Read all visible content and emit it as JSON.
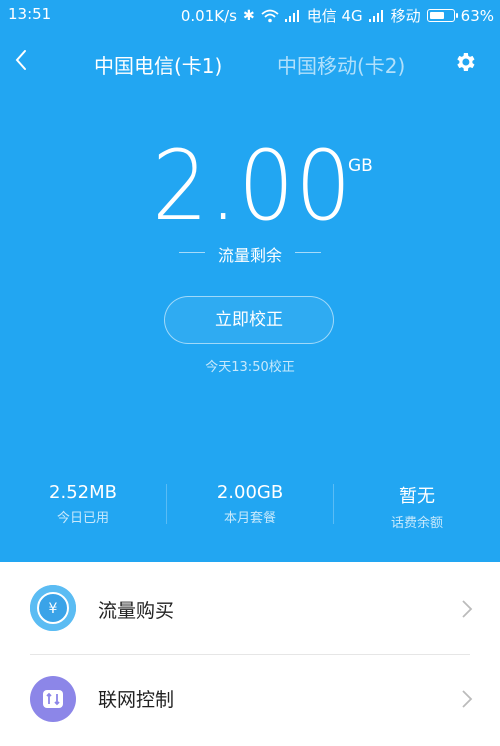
{
  "status_bar": {
    "time": "13:51",
    "speed": "0.01K/s",
    "carrier1": "电信 4G",
    "carrier2": "移动",
    "battery": "63%",
    "battery_level": 0.63
  },
  "header": {
    "tab_sim1": "中国电信(卡1)",
    "tab_sim2": "中国移动(卡2)"
  },
  "usage": {
    "remaining_value": "2.00",
    "remaining_unit": "GB",
    "remaining_label": "流量剩余",
    "calibrate_button": "立即校正",
    "calibrated_at": "今天13:50校正"
  },
  "stats": [
    {
      "value": "2.52MB",
      "label": "今日已用"
    },
    {
      "value": "2.00GB",
      "label": "本月套餐"
    },
    {
      "value": "暂无",
      "label": "话费余额"
    }
  ],
  "menu": {
    "items": [
      {
        "label": "流量购买",
        "icon": "yen-coin-icon"
      },
      {
        "label": "联网控制",
        "icon": "network-control-icon"
      }
    ]
  },
  "colors": {
    "accent": "#22a6f2",
    "icon_blue": "#5bbcf3",
    "icon_purple": "#8c86e8"
  }
}
